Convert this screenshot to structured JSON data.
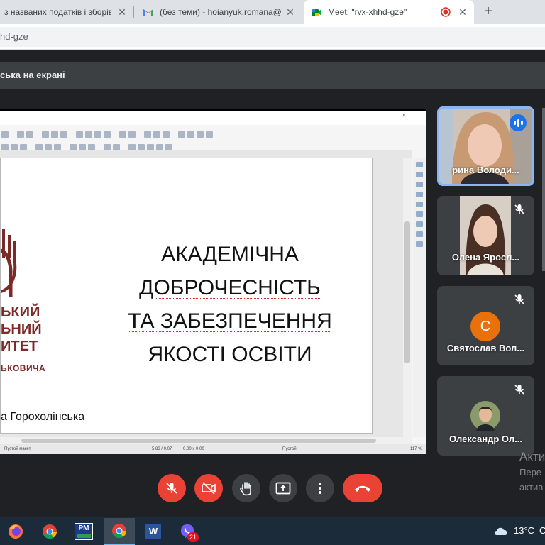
{
  "browser": {
    "tabs": [
      {
        "title": "з названих податків і зборів",
        "favicon": "doc-icon"
      },
      {
        "title": "(без теми) - hoianyuk.romana@",
        "favicon": "gmail-icon"
      },
      {
        "title": "Meet: \"rvx-xhhd-gze\"",
        "favicon": "meet-icon",
        "active": true,
        "recording": true
      }
    ],
    "close_glyph": "✕",
    "new_tab_glyph": "+",
    "url": "hd-gze"
  },
  "meet": {
    "presenting_text": "ська на екрані",
    "controls": [
      {
        "name": "mic-off",
        "state": "off",
        "color": "#ea4335"
      },
      {
        "name": "camera-off",
        "state": "off",
        "color": "#ea4335"
      },
      {
        "name": "raise-hand"
      },
      {
        "name": "present-now"
      },
      {
        "name": "more-options"
      },
      {
        "name": "leave-call",
        "color": "#ea4335"
      }
    ],
    "participants": [
      {
        "name": "рина Володи...",
        "speaking": true
      },
      {
        "name": "Олена Яросл...",
        "muted": true
      },
      {
        "name": "Святослав Вол...",
        "muted": true,
        "avatar_letter": "С",
        "avatar_color": "#e8710a"
      },
      {
        "name": "Олександр Ол...",
        "muted": true
      }
    ]
  },
  "slide": {
    "logo_lines": [
      "ЬКИЙ",
      "ЬНИЙ",
      "ИТЕТ",
      "ЬКОВИЧА"
    ],
    "title_lines": [
      "АКАДЕМІЧНА",
      "ДОБРОЧЕСНІСТЬ",
      "ТА ЗАБЕЗПЕЧЕННЯ",
      "ЯКОСТІ ОСВІТИ"
    ],
    "author": "а Горохолінська",
    "accent_color": "#7b2a27"
  },
  "libreoffice_status": {
    "layout": "Пустой макет",
    "position": "5.83 / 0.07",
    "size": "0.00 x 0.00",
    "style": "Пустой",
    "zoom": "117 %"
  },
  "watermark": {
    "line1": "Акти",
    "line2": "Пере",
    "line3": "актив"
  },
  "taskbar": {
    "apps": [
      "firefox-icon",
      "chrome-icon",
      "pm-icon",
      "chrome-active-icon",
      "word-icon",
      "viber-icon"
    ],
    "viber_badge": "21",
    "pm_label": "PM",
    "word_label": "W",
    "temperature": "13°C",
    "tray_more": "C"
  }
}
